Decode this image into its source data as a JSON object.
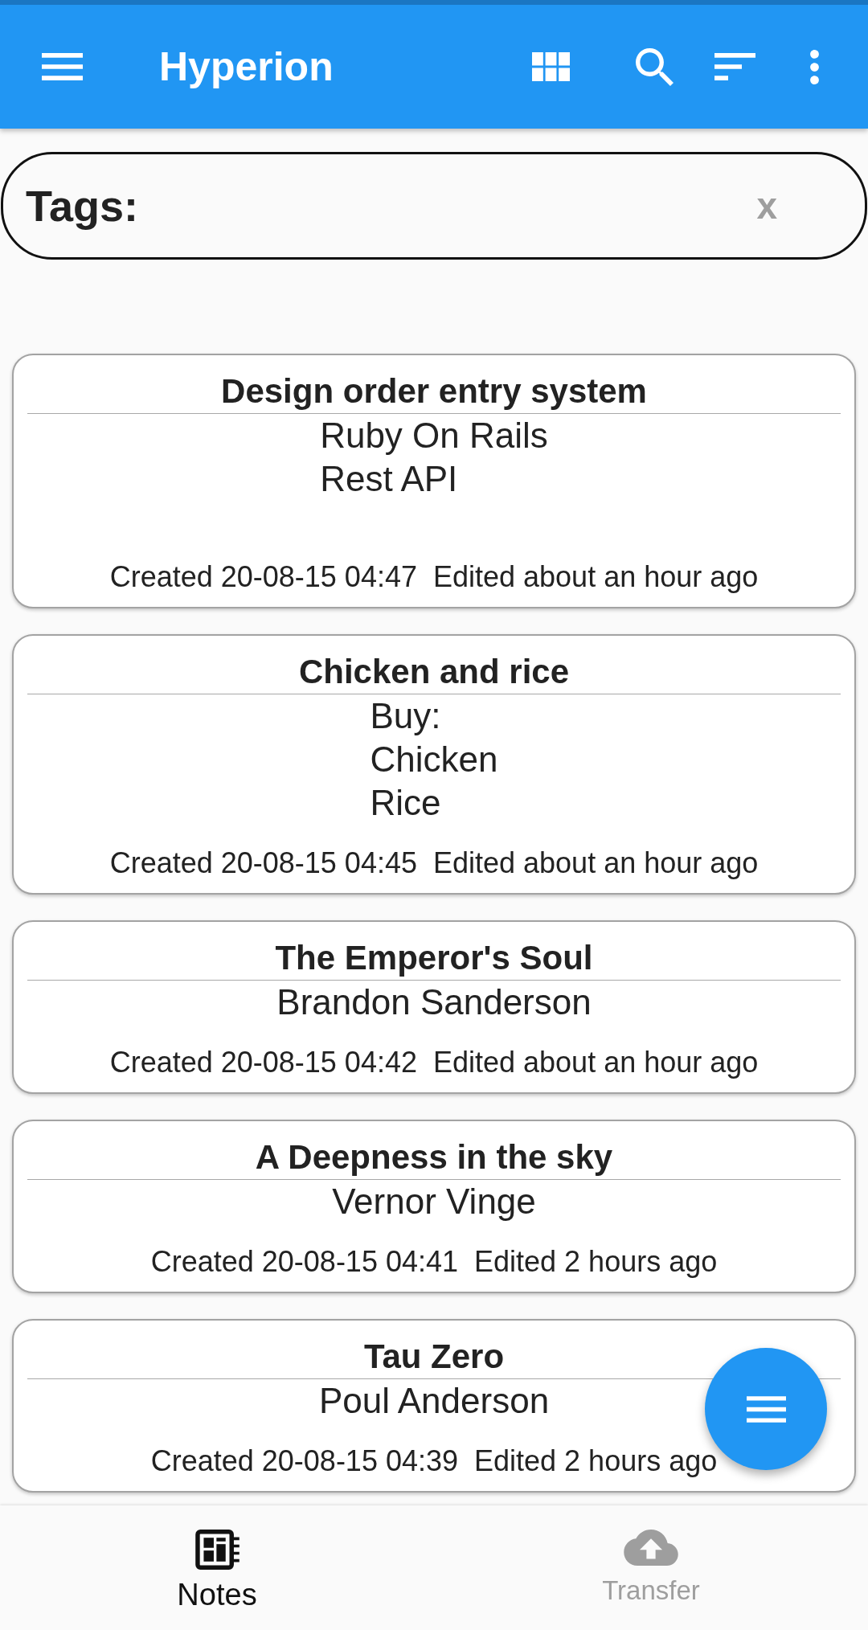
{
  "app_bar": {
    "title": "Hyperion"
  },
  "tag_filter": {
    "label": "Tags:",
    "clear": "x"
  },
  "notes": [
    {
      "title": "Design order entry system",
      "body": "Ruby On Rails\nRest API\n",
      "created": "Created 20-08-15 04:47",
      "edited": "Edited about an hour ago"
    },
    {
      "title": "Chicken and rice",
      "body": "Buy:\nChicken\nRice",
      "created": "Created 20-08-15 04:45",
      "edited": "Edited about an hour ago"
    },
    {
      "title": "The Emperor's Soul",
      "body": "Brandon Sanderson",
      "created": "Created 20-08-15 04:42",
      "edited": "Edited about an hour ago"
    },
    {
      "title": "A Deepness in the sky",
      "body": "Vernor Vinge",
      "created": "Created 20-08-15 04:41",
      "edited": "Edited 2 hours ago"
    },
    {
      "title": "Tau Zero",
      "body": "Poul Anderson",
      "created": "Created 20-08-15 04:39",
      "edited": "Edited 2 hours ago"
    }
  ],
  "bottom_nav": [
    {
      "label": "Notes",
      "selected": true
    },
    {
      "label": "Transfer",
      "selected": false
    }
  ]
}
